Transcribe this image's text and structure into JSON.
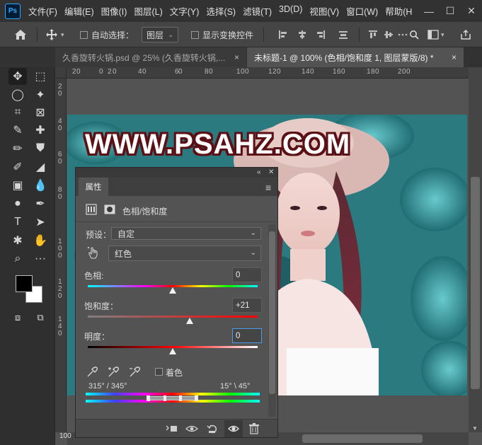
{
  "app": {
    "logo": "Ps"
  },
  "menu": [
    "文件(F)",
    "编辑(E)",
    "图像(I)",
    "图层(L)",
    "文字(Y)",
    "选择(S)",
    "滤镜(T)",
    "3D(D)",
    "视图(V)",
    "窗口(W)",
    "帮助(H"
  ],
  "window_controls": {
    "minimize": "—",
    "maximize": "☐",
    "close": "✕"
  },
  "options": {
    "auto_select_label": "自动选择：",
    "auto_select_value": "图层",
    "show_transform_label": "显示变换控件"
  },
  "tabs": [
    {
      "label": "久香旋转火锅.psd @ 25% (久香旋转火锅,..."
    },
    {
      "label": "未标题-1 @ 100% (色相/饱和度 1, 图层蒙版/8) *"
    }
  ],
  "tab_close": "×",
  "toolbar_collapse": "«",
  "ruler_top_labels": [
    "2",
    "0",
    "0",
    "2",
    "0",
    "4",
    "0",
    "6",
    "0",
    "8",
    "0",
    "1",
    "0",
    "0",
    "1",
    "2",
    "0",
    "1",
    "4",
    "0",
    "1",
    "6",
    "0",
    "1",
    "8",
    "0",
    "2",
    "0",
    "0"
  ],
  "ruler_left_labels": [
    "2",
    "0",
    "4",
    "0",
    "6",
    "0",
    "8",
    "0",
    "1",
    "0",
    "0",
    "1",
    "2",
    "0",
    "1",
    "4",
    "0"
  ],
  "watermark": "WWW.PSAHZ.COM",
  "zoom_status": "100",
  "panel": {
    "collapse": "«",
    "close": "✕",
    "tab": "属性",
    "menu_icon": "≡",
    "header": "色相/饱和度",
    "preset_label": "预设：",
    "preset_value": "自定",
    "channel_value": "红色",
    "hue_label": "色相:",
    "hue_value": "0",
    "hue_level": 0.5,
    "saturation_label": "饱和度：",
    "saturation_value": "+21",
    "saturation_level": 0.6,
    "lightness_label": "明度：",
    "lightness_value": "0",
    "lightness_level": 0.5,
    "colorize_label": "着色",
    "range_left": "315° / 345°",
    "range_right": "15° \\ 45°"
  },
  "colors": {
    "accent": "#31a8ff",
    "panel_bg": "#535353",
    "app_bg": "#323232"
  }
}
